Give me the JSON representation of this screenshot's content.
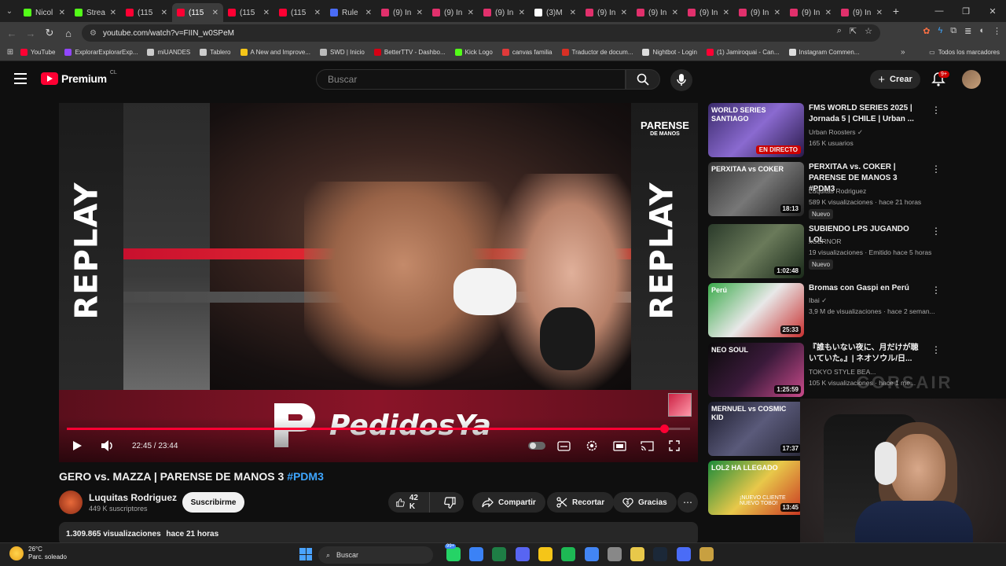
{
  "browser": {
    "tabs": [
      {
        "label": "Nicol",
        "color": "#53fc18",
        "active": false
      },
      {
        "label": "Strea",
        "color": "#53fc18",
        "active": false
      },
      {
        "label": "(115",
        "color": "#ff0033",
        "active": false
      },
      {
        "label": "(115",
        "color": "#ff0033",
        "active": true
      },
      {
        "label": "(115",
        "color": "#ff0033",
        "active": false
      },
      {
        "label": "(115",
        "color": "#ff0033",
        "active": false
      },
      {
        "label": "Rule",
        "color": "#4a6cf7",
        "active": false
      },
      {
        "label": "(9) In",
        "color": "#e1306c",
        "active": false
      },
      {
        "label": "(9) In",
        "color": "#e1306c",
        "active": false
      },
      {
        "label": "(9) In",
        "color": "#e1306c",
        "active": false
      },
      {
        "label": "(3)M",
        "color": "#ffffff",
        "active": false
      },
      {
        "label": "(9) In",
        "color": "#e1306c",
        "active": false
      },
      {
        "label": "(9) In",
        "color": "#e1306c",
        "active": false
      },
      {
        "label": "(9) In",
        "color": "#e1306c",
        "active": false
      },
      {
        "label": "(9) In",
        "color": "#e1306c",
        "active": false
      },
      {
        "label": "(9) In",
        "color": "#e1306c",
        "active": false
      },
      {
        "label": "(9) In",
        "color": "#e1306c",
        "active": false
      }
    ],
    "url": "youtube.com/watch?v=FIIN_w0SPeM",
    "bookmarks": [
      {
        "label": "YouTube",
        "color": "#ff0033"
      },
      {
        "label": "ExplorarExplorarExp...",
        "color": "#9146ff"
      },
      {
        "label": "miUANDES",
        "color": "#cccccc"
      },
      {
        "label": "Tablero",
        "color": "#cccccc"
      },
      {
        "label": "A New and Improve...",
        "color": "#f5c518"
      },
      {
        "label": "SWD | Inicio",
        "color": "#bbbbbb"
      },
      {
        "label": "BetterTTV - Dashbo...",
        "color": "#d50014"
      },
      {
        "label": "Kick Logo",
        "color": "#53fc18"
      },
      {
        "label": "canvas familia",
        "color": "#e03a3a"
      },
      {
        "label": "Traductor de docum...",
        "color": "#d93025"
      },
      {
        "label": "Nightbot - Login",
        "color": "#dddddd"
      },
      {
        "label": "(1) Jamiroquai - Can...",
        "color": "#ff0033"
      },
      {
        "label": "Instagram Commen...",
        "color": "#dddddd"
      }
    ],
    "bookmarks_all": "Todos los marcadores"
  },
  "youtube": {
    "logo_text": "Premium",
    "country": "CL",
    "search_placeholder": "Buscar",
    "create_label": "Crear",
    "notif_count": "9+",
    "video": {
      "replay_text": "REPLAY",
      "brand_top": "PARENSE",
      "brand_bottom": "DE MANOS",
      "sponsor": "PedidosYa",
      "time": "22:45 / 23:44",
      "progress": 0.959,
      "title_main": "GERO vs. MAZZA | PARENSE DE MANOS 3 ",
      "title_tag": "#PDM3",
      "channel": "Luquitas Rodriguez",
      "subs": "449 K suscriptores",
      "subscribe": "Suscribirme",
      "likes": "42 K",
      "share": "Compartir",
      "clip": "Recortar",
      "thanks": "Gracias",
      "views": "1.309.865 visualizaciones",
      "age": "hace 21 horas"
    },
    "recommendations": [
      {
        "title": "FMS WORLD SERIES 2025 | Jornada 5 | CHILE | Urban ...",
        "channel": "Urban Roosters ✓",
        "meta": "165 K usuarios",
        "badge": "EN DIRECTO",
        "nuevo": ""
      },
      {
        "title": "PERXITAA vs. COKER | PARENSE DE MANOS 3 #PDM3",
        "channel": "Luquitas Rodriguez",
        "meta": "589 K visualizaciones · hace 21 horas",
        "badge": "18:13",
        "nuevo": "Nuevo"
      },
      {
        "title": "SUBIENDO LPS JUGANDO LOL",
        "channel": "xGERNOR",
        "meta": "19 visualizaciones · Emitido hace 5 horas",
        "badge": "1:02:48",
        "nuevo": "Nuevo"
      },
      {
        "title": "Bromas con Gaspi en Perú",
        "channel": "Ibai ✓",
        "meta": "3,9 M de visualizaciones · hace 2 seman...",
        "badge": "25:33",
        "nuevo": ""
      },
      {
        "title": "『誰もいない夜に、月だけが聴いていた。』| ネオソウル/日...",
        "channel": "TOKYO STYLE BEA...",
        "meta": "105 K visualizaciones · hace 1 me...",
        "badge": "1:25:59",
        "nuevo": ""
      },
      {
        "title": "",
        "channel": "",
        "meta": "",
        "badge": "17:37",
        "nuevo": ""
      },
      {
        "title": "",
        "channel": "",
        "meta": "",
        "badge": "13:45",
        "nuevo": ""
      }
    ],
    "thumb_texts": {
      "t1": "WORLD SERIES SANTIAGO",
      "t2": "PERXITAA vs COKER",
      "t4": "Perú",
      "t5": "NEO SOUL",
      "t6": "MERNUEL vs COSMIC KID",
      "t7": "LOL2 HA LLEGADO",
      "t7_top": "¡NUEVO CLIENTE NUEVO TOBO!"
    }
  },
  "overlay": {
    "watermark": "CORSAIR"
  },
  "taskbar": {
    "temp": "26°C",
    "weather": "Parc. soleado",
    "search": "Buscar",
    "badge": "99+"
  }
}
